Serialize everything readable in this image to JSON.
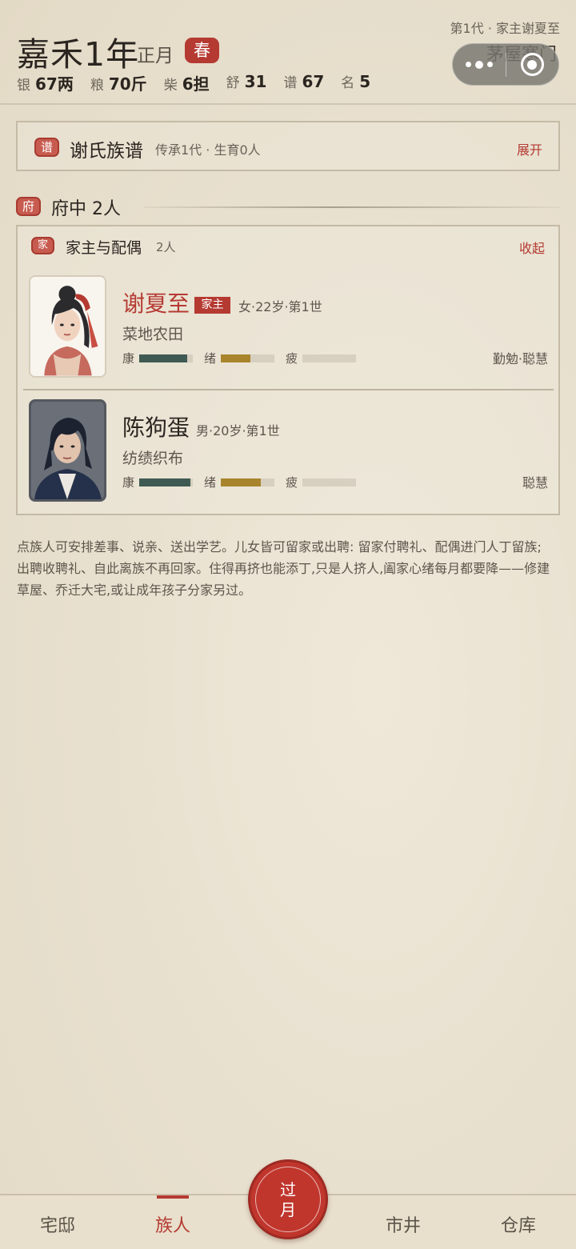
{
  "header": {
    "year_title": "嘉禾1年",
    "month": "正月",
    "season": "春",
    "generation_info": "第1代 · 家主谢夏至",
    "home_name": "茅屋寒门",
    "stats": [
      {
        "label": "银",
        "value": "67两"
      },
      {
        "label": "粮",
        "value": "70斤"
      },
      {
        "label": "柴",
        "value": "6担"
      },
      {
        "label": "舒",
        "value": "31"
      },
      {
        "label": "谱",
        "value": "67"
      },
      {
        "label": "名",
        "value": "5"
      }
    ]
  },
  "genealogy": {
    "badge": "谱",
    "title": "谢氏族谱",
    "subtitle": "传承1代 · 生育0人",
    "expand_label": "展开"
  },
  "residence": {
    "badge": "府",
    "title": "府中 2人"
  },
  "family_group": {
    "badge": "家",
    "title": "家主与配偶",
    "count": "2人",
    "collapse_label": "收起",
    "members": [
      {
        "name": "谢夏至",
        "badge": "家主",
        "info": "女·22岁·第1世",
        "job": "菜地农田",
        "traits": "勤勉·聪慧",
        "bars": [
          {
            "label": "康",
            "level": 0.9,
            "color": "#3f5a52"
          },
          {
            "label": "绪",
            "level": 0.55,
            "color": "#a8842c"
          },
          {
            "label": "疲",
            "level": 0.0,
            "color": "#b8ad98"
          }
        ]
      },
      {
        "name": "陈狗蛋",
        "info": "男·20岁·第1世",
        "job": "纺绩织布",
        "traits": "聪慧",
        "bars": [
          {
            "label": "康",
            "level": 0.95,
            "color": "#3f5a52"
          },
          {
            "label": "绪",
            "level": 0.75,
            "color": "#a8842c"
          },
          {
            "label": "疲",
            "level": 0.0,
            "color": "#b8ad98"
          }
        ]
      }
    ]
  },
  "help_text": "点族人可安排差事、说亲、送出学艺。儿女皆可留家或出聘: 留家付聘礼、配偶进门人丁留族; 出聘收聘礼、自此离族不再回家。住得再挤也能添丁,只是人挤人,阖家心绪每月都要降——修建草屋、乔迁大宅,或让成年孩子分家另过。",
  "nav": {
    "tabs": [
      "宅邸",
      "族人",
      "市井",
      "仓库"
    ],
    "active": "族人",
    "fab_line1": "过",
    "fab_line2": "月"
  },
  "colors": {
    "accent": "#b53a32",
    "health": "#3f5a52",
    "mood": "#a8842c"
  }
}
